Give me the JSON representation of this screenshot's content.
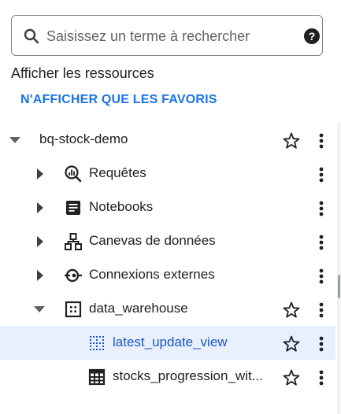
{
  "search": {
    "placeholder": "Saisissez un terme à rechercher",
    "value": ""
  },
  "show_resources_label": "Afficher les ressources",
  "favorites_link": "N'AFFICHER QUE LES FAVORIS",
  "tree": {
    "project": {
      "label": "bq-stock-demo",
      "icon": "caret-down-icon"
    },
    "items": [
      {
        "label": "Requêtes",
        "icon": "query-icon"
      },
      {
        "label": "Notebooks",
        "icon": "notebook-icon"
      },
      {
        "label": "Canevas de données",
        "icon": "data-canvas-icon"
      },
      {
        "label": "Connexions externes",
        "icon": "external-connection-icon"
      },
      {
        "label": "data_warehouse",
        "icon": "dataset-icon"
      },
      {
        "label": "latest_update_view",
        "icon": "view-icon"
      },
      {
        "label": "stocks_progression_wit...",
        "icon": "table-icon"
      }
    ]
  },
  "colors": {
    "accent": "#1a73e8",
    "selected_bg": "#e8f0fe",
    "text": "#202124"
  }
}
